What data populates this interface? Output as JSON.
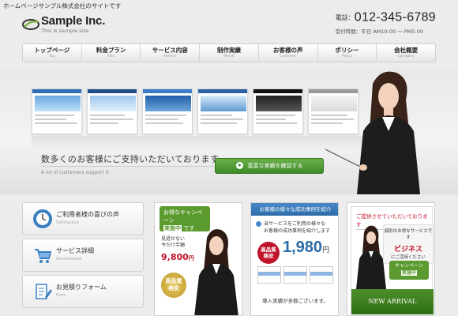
{
  "header": {
    "tagline": "ホームページサンプル株式会社のサイトです",
    "logo_title": "Sample Inc.",
    "logo_subtitle": "This is sample site.",
    "phone_label": "電話：",
    "phone_number": "012-345-6789",
    "hours": "受付時間：平日 AM10:00 〜 PM5:00"
  },
  "nav": [
    {
      "label": "トップページ",
      "sub": "Top"
    },
    {
      "label": "料金プラン",
      "sub": "Plan"
    },
    {
      "label": "サービス内容",
      "sub": "Service"
    },
    {
      "label": "制作実績",
      "sub": "Result"
    },
    {
      "label": "お客様の声",
      "sub": "Customer"
    },
    {
      "label": "ポリシー",
      "sub": "Policy"
    },
    {
      "label": "会社概要",
      "sub": "Company"
    }
  ],
  "hero": {
    "headline": "数多くのお客様にご支持いただいております。",
    "subline": "A lot of customers support it.",
    "cta_label": "豊富な実績を確認する"
  },
  "side_menu": [
    {
      "label": "ご利用者様の喜びの声",
      "sub": "Satisfaction"
    },
    {
      "label": "サービス詳細",
      "sub": "Servicedetail"
    },
    {
      "label": "お見積りフォーム",
      "sub": "Form"
    }
  ],
  "banner_campaign": {
    "line1": "お得なキャンペーン",
    "highlight": "実施中",
    "suffix": "です",
    "text1": "見逃せない",
    "text2": "今だけ半額",
    "price": "9,800",
    "price_unit": "円",
    "badge_line1": "高品質",
    "badge_line2": "格安"
  },
  "banner_results": {
    "header": "お客様の様々な成功事例を紹介",
    "text1": "当サービスをご利用の様々な",
    "text2": "お客様の成功事例を紹介します",
    "seal_line1": "高品質",
    "seal_line2": "格安",
    "price": "1,980",
    "price_unit": "円",
    "footer": "導入実績が多数ございます。"
  },
  "banner_arrival": {
    "header": "ご提供させていただいております",
    "bubble_line1": "個別のお得なサービスです",
    "bubble_big1": "ビジネス",
    "bubble_big2": "にご活用ください",
    "button_line1": "キャンペーン",
    "button_highlight": "実施中",
    "footer": "NEW ARRIVAL"
  },
  "colors": {
    "accent_green": "#5a9a2e",
    "accent_blue": "#2c6ba8",
    "accent_red": "#c0142b"
  }
}
